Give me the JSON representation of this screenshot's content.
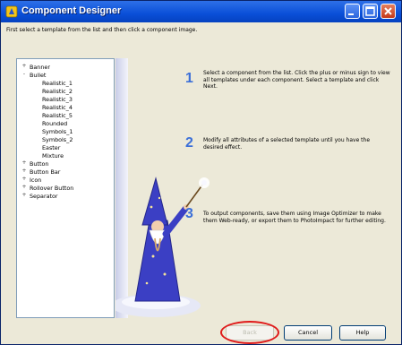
{
  "window": {
    "title": "Component Designer"
  },
  "instruction": "First select a template from the list and then click a component image.",
  "tree": {
    "items": [
      {
        "label": "Banner",
        "expander": "+"
      },
      {
        "label": "Bullet",
        "expander": "-"
      },
      {
        "label": "Realistic_1"
      },
      {
        "label": "Realistic_2"
      },
      {
        "label": "Realistic_3"
      },
      {
        "label": "Realistic_4"
      },
      {
        "label": "Realistic_5"
      },
      {
        "label": "Rounded"
      },
      {
        "label": "Symbols_1"
      },
      {
        "label": "Symbols_2"
      },
      {
        "label": "Easter"
      },
      {
        "label": "Mixture"
      },
      {
        "label": "Button",
        "expander": "+"
      },
      {
        "label": "Button Bar",
        "expander": "+"
      },
      {
        "label": "Icon",
        "expander": "+"
      },
      {
        "label": "Rollover Button",
        "expander": "+"
      },
      {
        "label": "Separator",
        "expander": "+"
      }
    ]
  },
  "steps": [
    {
      "number": "1",
      "text": "Select a component from the list. Click the plus or minus sign to view all templates under each component. Select a template and click Next."
    },
    {
      "number": "2",
      "text": "Modify all attributes of a selected template until you have the desired effect."
    },
    {
      "number": "3",
      "text": "To output components, save them using Image Optimizer to make them Web-ready, or export them to PhotoImpact for further editing."
    }
  ],
  "buttons": {
    "back": "Back",
    "cancel": "Cancel",
    "help": "Help"
  },
  "icons": {
    "title": "wizard-app-icon",
    "minimize": "minimize-icon",
    "maximize": "maximize-icon",
    "close": "close-icon"
  },
  "colors": {
    "titlebar": "#0a4fd8",
    "dialog": "#ece9d8",
    "highlight": "#e01a1a",
    "step_number": "#3b6fd8"
  }
}
